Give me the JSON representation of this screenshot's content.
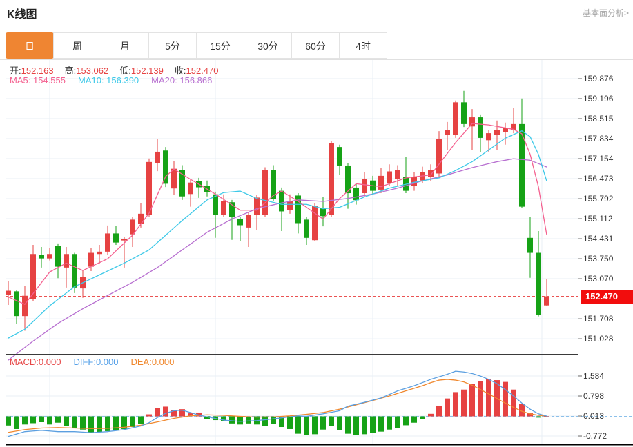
{
  "header": {
    "title": "K线图",
    "link": "基本面分析>"
  },
  "tabs": {
    "active_index": 0,
    "items": [
      {
        "label": "日",
        "name": "tab-day"
      },
      {
        "label": "周",
        "name": "tab-week"
      },
      {
        "label": "月",
        "name": "tab-month"
      },
      {
        "label": "5分",
        "name": "tab-5min"
      },
      {
        "label": "15分",
        "name": "tab-15min"
      },
      {
        "label": "30分",
        "name": "tab-30min"
      },
      {
        "label": "60分",
        "name": "tab-60min"
      },
      {
        "label": "4时",
        "name": "tab-4hour"
      }
    ]
  },
  "ohlc": {
    "open_label": "开:",
    "open": "152.163",
    "high_label": "高:",
    "high": "153.062",
    "low_label": "低:",
    "low": "152.139",
    "close_label": "收:",
    "close": "152.470"
  },
  "ma": {
    "ma5_label": "MA5:",
    "ma5": "154.555",
    "ma10_label": "MA10:",
    "ma10": "156.390",
    "ma20_label": "MA20:",
    "ma20": "156.866"
  },
  "macd_header": {
    "macd_label": "MACD:",
    "macd": "0.000",
    "diff_label": "DIFF:",
    "diff": "0.000",
    "dea_label": "DEA:",
    "dea": "0.000"
  },
  "price_axis": {
    "ticks": [
      159.876,
      159.196,
      158.515,
      157.834,
      157.154,
      156.473,
      155.792,
      155.112,
      154.431,
      153.75,
      153.07,
      151.708,
      151.028
    ],
    "badge": "152.470"
  },
  "macd_axis": {
    "ticks": [
      1.584,
      0.798,
      0.013,
      -0.772
    ]
  },
  "colors": {
    "up": "#e64242",
    "down": "#16a216",
    "ma5": "#f4608f",
    "ma10": "#3ec9e8",
    "ma20": "#b76fd0",
    "diff": "#5b9fe0",
    "dea": "#f0882e",
    "tab_accent": "#ef8532",
    "badge": "#f20d0d",
    "grid": "#e9eff6",
    "axis_dark": "#3a3a3a",
    "border_light": "#e0e0e0",
    "price_line": "#e73b3b",
    "zero_dash": "#8cc0ea"
  },
  "chart_data": {
    "type": "candlestick+macd",
    "title": "K线图",
    "current_price": 152.47,
    "candles": [
      [
        152.51,
        152.98,
        152.18,
        152.66
      ],
      [
        152.64,
        152.67,
        151.53,
        151.8
      ],
      [
        151.8,
        152.82,
        151.3,
        152.49
      ],
      [
        152.39,
        154.22,
        152.3,
        153.91
      ],
      [
        153.87,
        154.15,
        153.45,
        153.76
      ],
      [
        153.76,
        154.11,
        153.69,
        153.91
      ],
      [
        154.19,
        154.27,
        153.09,
        153.48
      ],
      [
        153.45,
        154.15,
        152.77,
        153.91
      ],
      [
        153.91,
        153.95,
        152.58,
        152.77
      ],
      [
        152.74,
        153.36,
        152.42,
        153.13
      ],
      [
        153.48,
        154.11,
        153.33,
        153.95
      ],
      [
        153.91,
        154.22,
        153.57,
        153.99
      ],
      [
        153.99,
        154.88,
        153.87,
        154.61
      ],
      [
        154.61,
        154.86,
        154.22,
        154.3
      ],
      [
        154.37,
        154.5,
        153.45,
        154.41
      ],
      [
        154.58,
        155.16,
        154.15,
        155.08
      ],
      [
        154.93,
        155.63,
        154.81,
        155.28
      ],
      [
        155.24,
        157.16,
        155.16,
        157.04
      ],
      [
        157.0,
        157.81,
        156.73,
        157.39
      ],
      [
        157.43,
        157.55,
        156.19,
        156.3
      ],
      [
        156.14,
        157.08,
        155.91,
        156.81
      ],
      [
        156.77,
        156.93,
        155.75,
        155.87
      ],
      [
        155.95,
        156.45,
        155.52,
        156.34
      ],
      [
        156.38,
        156.5,
        155.82,
        156.18
      ],
      [
        156.22,
        156.41,
        155.87,
        156.02
      ],
      [
        155.94,
        156.03,
        154.46,
        155.24
      ],
      [
        155.24,
        155.94,
        155.16,
        155.71
      ],
      [
        155.67,
        155.75,
        154.39,
        155.16
      ],
      [
        155.09,
        155.16,
        154.34,
        154.89
      ],
      [
        154.81,
        155.33,
        154.15,
        155.24
      ],
      [
        155.24,
        155.92,
        154.73,
        155.83
      ],
      [
        155.24,
        156.86,
        155.16,
        156.77
      ],
      [
        156.77,
        156.93,
        155.7,
        155.79
      ],
      [
        156.06,
        156.17,
        154.69,
        155.36
      ],
      [
        155.4,
        155.94,
        155.28,
        155.71
      ],
      [
        155.9,
        155.98,
        154.61,
        154.96
      ],
      [
        155.08,
        155.16,
        154.22,
        154.46
      ],
      [
        154.38,
        155.63,
        154.34,
        155.55
      ],
      [
        155.47,
        155.86,
        154.85,
        155.2
      ],
      [
        155.24,
        157.74,
        155.16,
        157.67
      ],
      [
        157.55,
        157.63,
        156.61,
        156.92
      ],
      [
        156.92,
        156.99,
        155.45,
        155.98
      ],
      [
        156.17,
        156.29,
        155.59,
        155.74
      ],
      [
        155.98,
        156.69,
        155.87,
        156.45
      ],
      [
        156.41,
        156.57,
        155.94,
        156.06
      ],
      [
        156.1,
        156.85,
        155.98,
        156.57
      ],
      [
        156.33,
        156.96,
        156.22,
        156.72
      ],
      [
        156.45,
        156.93,
        156.22,
        156.76
      ],
      [
        156.53,
        157.22,
        155.98,
        156.06
      ],
      [
        156.22,
        156.69,
        156.06,
        156.53
      ],
      [
        156.41,
        156.88,
        156.33,
        156.69
      ],
      [
        156.53,
        156.96,
        156.38,
        156.76
      ],
      [
        156.65,
        158.09,
        156.5,
        157.82
      ],
      [
        157.97,
        158.4,
        157.46,
        158.13
      ],
      [
        157.97,
        159.13,
        157.86,
        159.07
      ],
      [
        159.07,
        159.46,
        158.23,
        158.33
      ],
      [
        158.25,
        158.84,
        157.44,
        158.56
      ],
      [
        158.56,
        158.66,
        157.39,
        157.86
      ],
      [
        157.78,
        158.14,
        157.39,
        158.02
      ],
      [
        157.97,
        158.45,
        157.44,
        158.13
      ],
      [
        158.05,
        158.38,
        157.63,
        158.21
      ],
      [
        158.13,
        158.87,
        158.02,
        158.33
      ],
      [
        158.33,
        159.2,
        155.47,
        155.52
      ],
      [
        154.46,
        155.16,
        153.1,
        153.95
      ],
      [
        153.95,
        154.69,
        151.79,
        151.84
      ],
      [
        152.163,
        153.062,
        152.139,
        152.47
      ]
    ],
    "ma5_points": [
      [
        0,
        152.45
      ],
      [
        2,
        152.2
      ],
      [
        5,
        153.3
      ],
      [
        7,
        153.6
      ],
      [
        9,
        153.35
      ],
      [
        12,
        153.75
      ],
      [
        15,
        154.55
      ],
      [
        17,
        155.3
      ],
      [
        19,
        156.55
      ],
      [
        20,
        156.8
      ],
      [
        22,
        156.45
      ],
      [
        25,
        155.95
      ],
      [
        28,
        155.4
      ],
      [
        30,
        155.4
      ],
      [
        32,
        155.9
      ],
      [
        33,
        156.05
      ],
      [
        35,
        155.7
      ],
      [
        38,
        155.1
      ],
      [
        40,
        155.8
      ],
      [
        42,
        156.3
      ],
      [
        45,
        156.2
      ],
      [
        48,
        156.5
      ],
      [
        51,
        156.6
      ],
      [
        54,
        157.7
      ],
      [
        56,
        158.35
      ],
      [
        58,
        158.3
      ],
      [
        61,
        158.15
      ],
      [
        62,
        158.0
      ],
      [
        63,
        157.3
      ],
      [
        64,
        156.2
      ],
      [
        65,
        154.56
      ]
    ],
    "ma10_points": [
      [
        0,
        151.05
      ],
      [
        2,
        151.35
      ],
      [
        5,
        152.15
      ],
      [
        8,
        152.8
      ],
      [
        11,
        153.2
      ],
      [
        14,
        153.6
      ],
      [
        17,
        154.05
      ],
      [
        19,
        154.55
      ],
      [
        21,
        155.05
      ],
      [
        24,
        155.75
      ],
      [
        26,
        156.0
      ],
      [
        28,
        156.05
      ],
      [
        30,
        155.8
      ],
      [
        33,
        155.6
      ],
      [
        36,
        155.6
      ],
      [
        38,
        155.45
      ],
      [
        40,
        155.5
      ],
      [
        43,
        155.85
      ],
      [
        46,
        156.15
      ],
      [
        49,
        156.35
      ],
      [
        52,
        156.5
      ],
      [
        54,
        156.75
      ],
      [
        56,
        157.05
      ],
      [
        58,
        157.45
      ],
      [
        60,
        157.85
      ],
      [
        62,
        158.1
      ],
      [
        63,
        157.9
      ],
      [
        64,
        157.3
      ],
      [
        65,
        156.39
      ]
    ],
    "ma20_points": [
      [
        0,
        150.3
      ],
      [
        3,
        150.95
      ],
      [
        6,
        151.55
      ],
      [
        9,
        152.05
      ],
      [
        12,
        152.5
      ],
      [
        15,
        152.95
      ],
      [
        18,
        153.45
      ],
      [
        21,
        154.05
      ],
      [
        24,
        154.65
      ],
      [
        27,
        155.1
      ],
      [
        30,
        155.45
      ],
      [
        33,
        155.65
      ],
      [
        35,
        155.75
      ],
      [
        38,
        155.7
      ],
      [
        41,
        155.8
      ],
      [
        44,
        155.95
      ],
      [
        47,
        156.15
      ],
      [
        50,
        156.4
      ],
      [
        53,
        156.6
      ],
      [
        56,
        156.85
      ],
      [
        59,
        157.05
      ],
      [
        61,
        157.15
      ],
      [
        63,
        157.1
      ],
      [
        65,
        156.87
      ]
    ],
    "macd_histogram": [
      -0.36,
      -0.5,
      -0.32,
      -0.27,
      -0.23,
      -0.32,
      -0.25,
      -0.38,
      -0.45,
      -0.52,
      -0.65,
      -0.62,
      -0.58,
      -0.55,
      -0.5,
      -0.42,
      -0.3,
      0.08,
      0.32,
      0.38,
      0.25,
      0.28,
      0.12,
      0.15,
      -0.1,
      -0.15,
      -0.2,
      -0.28,
      -0.32,
      -0.28,
      -0.32,
      -0.38,
      -0.3,
      -0.42,
      -0.5,
      -0.68,
      -0.72,
      -0.7,
      -0.52,
      -0.38,
      -0.55,
      -0.68,
      -0.72,
      -0.7,
      -0.65,
      -0.6,
      -0.52,
      -0.45,
      -0.35,
      -0.25,
      -0.12,
      0.1,
      0.42,
      0.7,
      0.95,
      1.05,
      1.28,
      1.38,
      1.46,
      1.42,
      1.35,
      1.05,
      0.5,
      0.12,
      -0.05,
      0.0
    ],
    "diff_points": [
      [
        0,
        -0.79
      ],
      [
        2,
        -0.6
      ],
      [
        4,
        -0.55
      ],
      [
        6,
        -0.6
      ],
      [
        8,
        -0.6
      ],
      [
        10,
        -0.64
      ],
      [
        12,
        -0.6
      ],
      [
        14,
        -0.52
      ],
      [
        16,
        -0.38
      ],
      [
        17,
        -0.25
      ],
      [
        18,
        -0.05
      ],
      [
        19,
        0.12
      ],
      [
        20,
        0.22
      ],
      [
        21,
        0.24
      ],
      [
        22,
        0.15
      ],
      [
        23,
        0.05
      ],
      [
        24,
        -0.02
      ],
      [
        26,
        -0.15
      ],
      [
        28,
        -0.2
      ],
      [
        30,
        -0.17
      ],
      [
        32,
        -0.1
      ],
      [
        34,
        -0.02
      ],
      [
        35,
        0.02
      ],
      [
        36,
        0.0
      ],
      [
        38,
        0.1
      ],
      [
        40,
        0.22
      ],
      [
        41,
        0.4
      ],
      [
        43,
        0.55
      ],
      [
        45,
        0.72
      ],
      [
        47,
        1.0
      ],
      [
        49,
        1.2
      ],
      [
        51,
        1.45
      ],
      [
        53,
        1.65
      ],
      [
        54,
        1.77
      ],
      [
        55,
        1.74
      ],
      [
        56,
        1.68
      ],
      [
        57,
        1.58
      ],
      [
        58,
        1.45
      ],
      [
        59,
        1.28
      ],
      [
        60,
        1.05
      ],
      [
        61,
        0.8
      ],
      [
        62,
        0.52
      ],
      [
        63,
        0.28
      ],
      [
        64,
        0.1
      ],
      [
        65,
        0.01
      ]
    ],
    "dea_points": [
      [
        0,
        -0.63
      ],
      [
        2,
        -0.52
      ],
      [
        4,
        -0.46
      ],
      [
        6,
        -0.44
      ],
      [
        8,
        -0.46
      ],
      [
        10,
        -0.48
      ],
      [
        12,
        -0.47
      ],
      [
        14,
        -0.43
      ],
      [
        16,
        -0.35
      ],
      [
        18,
        -0.22
      ],
      [
        20,
        -0.08
      ],
      [
        22,
        0.02
      ],
      [
        24,
        0.06
      ],
      [
        26,
        0.04
      ],
      [
        28,
        0.0
      ],
      [
        30,
        -0.03
      ],
      [
        32,
        -0.02
      ],
      [
        34,
        0.02
      ],
      [
        36,
        0.08
      ],
      [
        38,
        0.15
      ],
      [
        40,
        0.28
      ],
      [
        42,
        0.45
      ],
      [
        44,
        0.62
      ],
      [
        46,
        0.8
      ],
      [
        48,
        1.0
      ],
      [
        50,
        1.2
      ],
      [
        51,
        1.32
      ],
      [
        52,
        1.42
      ],
      [
        53,
        1.45
      ],
      [
        54,
        1.42
      ],
      [
        55,
        1.35
      ],
      [
        56,
        1.22
      ],
      [
        57,
        1.05
      ],
      [
        58,
        0.88
      ],
      [
        59,
        0.7
      ],
      [
        60,
        0.52
      ],
      [
        61,
        0.35
      ],
      [
        62,
        0.2
      ],
      [
        63,
        0.1
      ],
      [
        64,
        0.04
      ],
      [
        65,
        0.01
      ]
    ]
  }
}
